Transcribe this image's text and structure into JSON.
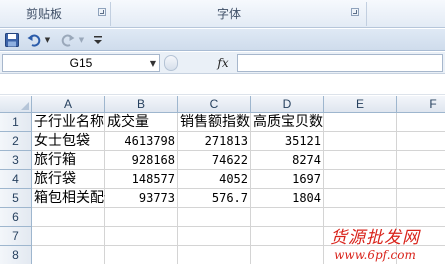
{
  "ribbon": {
    "groups": [
      {
        "label": "剪贴板"
      },
      {
        "label": "字体"
      }
    ]
  },
  "name_box": {
    "value": "G15"
  },
  "formula_bar": {
    "fx_label": "fx",
    "value": ""
  },
  "sheet": {
    "columns": [
      "A",
      "B",
      "C",
      "D",
      "E",
      "F"
    ],
    "rows": [
      {
        "num": "1",
        "cells": [
          "子行业名称",
          "成交量",
          "销售额指数",
          "高质宝贝数",
          "",
          ""
        ]
      },
      {
        "num": "2",
        "cells": [
          "女士包袋",
          "4613798",
          "271813",
          "35121",
          "",
          ""
        ]
      },
      {
        "num": "3",
        "cells": [
          "旅行箱",
          "928168",
          "74622",
          "8274",
          "",
          ""
        ]
      },
      {
        "num": "4",
        "cells": [
          "旅行袋",
          "148577",
          "4052",
          "1697",
          "",
          ""
        ]
      },
      {
        "num": "5",
        "cells": [
          "箱包相关配件",
          "93773",
          "576.7",
          "1804",
          "",
          ""
        ]
      },
      {
        "num": "6",
        "cells": [
          "",
          "",
          "",
          "",
          "",
          ""
        ]
      },
      {
        "num": "7",
        "cells": [
          "",
          "",
          "",
          "",
          "",
          ""
        ]
      },
      {
        "num": "8",
        "cells": [
          "",
          "",
          "",
          "",
          "",
          ""
        ]
      }
    ]
  },
  "watermark": {
    "title": "货源批发网",
    "url": "www.6pf.com"
  }
}
